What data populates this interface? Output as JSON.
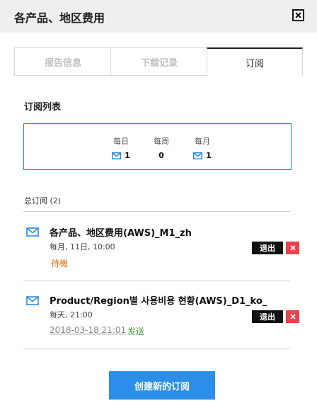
{
  "dialog": {
    "title": "各产品、地区费用"
  },
  "tabs": [
    {
      "label": "报告信息",
      "active": false
    },
    {
      "label": "下载记录",
      "active": false
    },
    {
      "label": "订阅",
      "active": true
    }
  ],
  "subscription_list": {
    "title": "订阅列表",
    "columns": [
      {
        "label": "每日",
        "value": "1",
        "icon": "mail-icon"
      },
      {
        "label": "每周",
        "value": "0",
        "icon": ""
      },
      {
        "label": "每月",
        "value": "1",
        "icon": "mail-icon"
      }
    ]
  },
  "total": {
    "label": "总订阅 (2)"
  },
  "items": [
    {
      "title": "各产品、地区费用(AWS)_M1_zh",
      "schedule": "每月, 11日, 10:00",
      "date": "",
      "status": "待機"
    },
    {
      "title": "Product/Region별 사용비용 현황(AWS)_D1_ko_",
      "schedule": "每天, 21:00",
      "date": "2018-03-18 21:01",
      "status": "发送"
    }
  ],
  "buttons": {
    "exit": "退出",
    "create": "创建新的订阅"
  },
  "colors": {
    "accent": "#2b8ee8",
    "delete": "#e8424c",
    "pending": "#e0731a",
    "sent": "#3f9c35"
  }
}
